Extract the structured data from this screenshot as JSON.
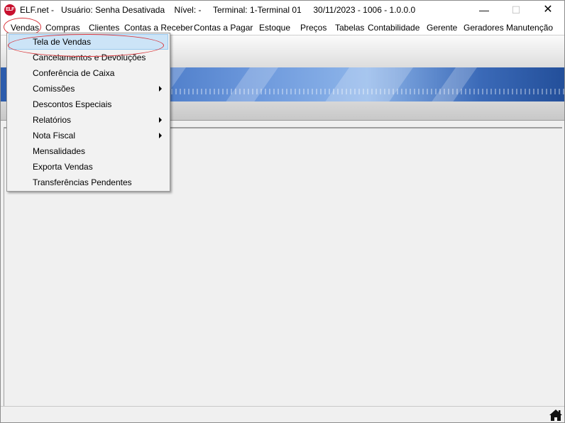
{
  "titlebar": {
    "app_name": "ELF.net -",
    "user": "Usuário: Senha Desativada",
    "level": "Nível: -",
    "terminal": "Terminal: 1-Terminal 01",
    "info": "30/11/2023 - 1006 - 1.0.0.0",
    "logo_text": "ELF",
    "minimize": "—",
    "maximize": "☐",
    "close": "✕"
  },
  "menubar": {
    "items": [
      "Vendas",
      "Compras",
      "Clientes",
      "Contas a Receber",
      "Contas a Pagar",
      "Estoque",
      "Preços",
      "Tabelas",
      "Contabilidade",
      "Gerente",
      "Geradores",
      "Manutenção"
    ]
  },
  "dropdown": {
    "items": [
      {
        "label": "Tela de Vendas",
        "submenu": false,
        "selected": true
      },
      {
        "label": "Cancelamentos e Devoluções",
        "submenu": false
      },
      {
        "label": "Conferência de Caixa",
        "submenu": false
      },
      {
        "label": "Comissões",
        "submenu": true
      },
      {
        "label": "Descontos Especiais",
        "submenu": false
      },
      {
        "label": "Relatórios",
        "submenu": true
      },
      {
        "label": "Nota Fiscal",
        "submenu": true
      },
      {
        "label": "Mensalidades",
        "submenu": false
      },
      {
        "label": "Exporta Vendas",
        "submenu": false
      },
      {
        "label": "Transferências Pendentes",
        "submenu": false
      }
    ]
  },
  "colors": {
    "highlight": "#cce4f7",
    "annotation": "#d8343a",
    "banner": "#3f70c0"
  },
  "icons": {
    "status_home": "home-icon"
  }
}
